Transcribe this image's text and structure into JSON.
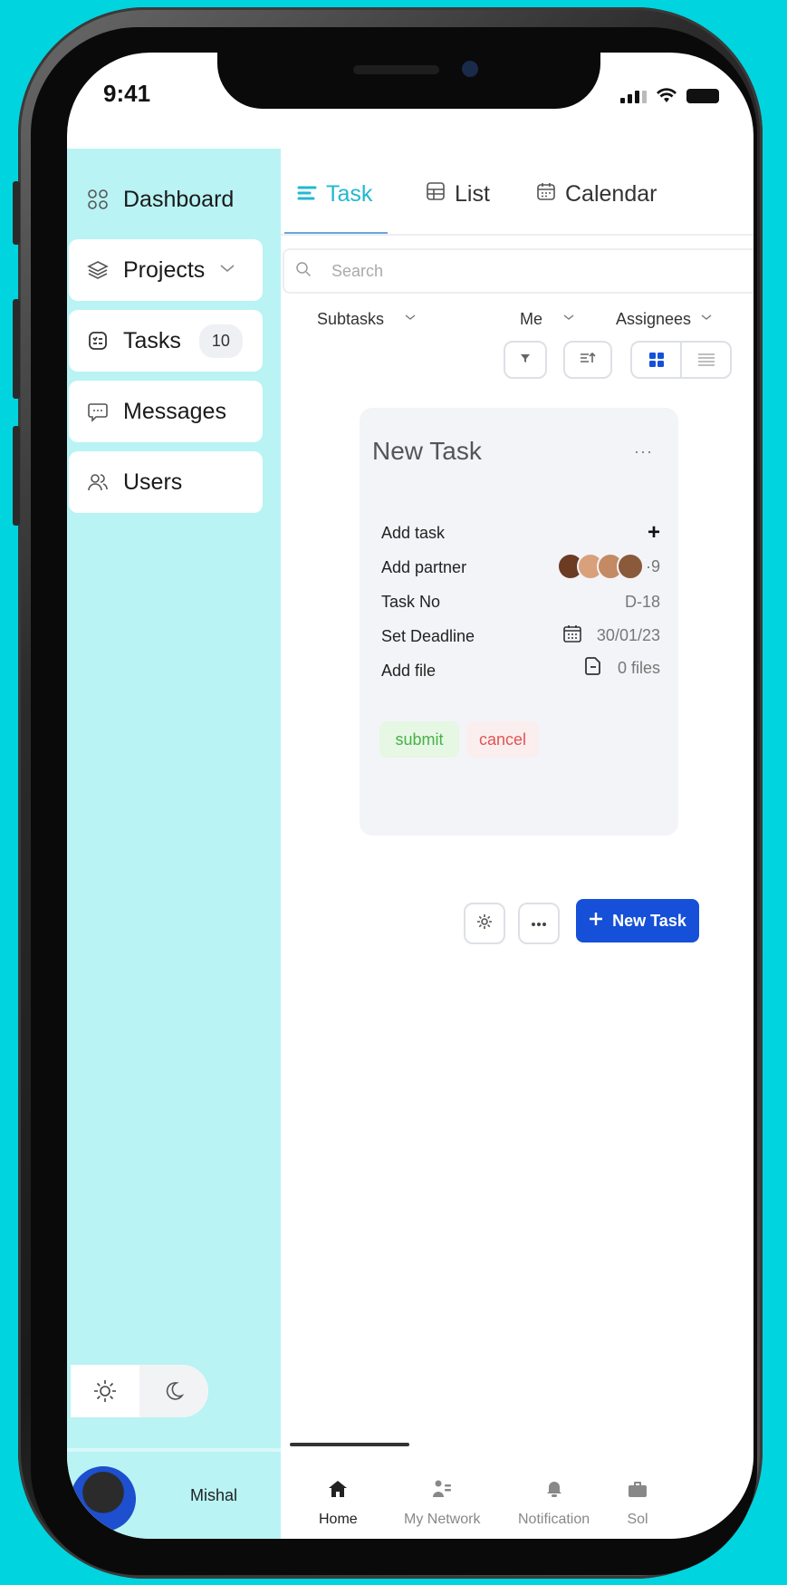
{
  "status_bar": {
    "time": "9:41"
  },
  "sidebar": {
    "items": [
      {
        "label": "Dashboard",
        "icon": "grid-icon"
      },
      {
        "label": "Projects",
        "icon": "layers-icon",
        "has_chevron": true
      },
      {
        "label": "Tasks",
        "icon": "tasklist-icon",
        "badge": "10"
      },
      {
        "label": "Messages",
        "icon": "message-icon"
      },
      {
        "label": "Users",
        "icon": "users-icon"
      }
    ],
    "user_name": "Mishal"
  },
  "tabs": [
    {
      "label": "Task",
      "icon": "lines-icon",
      "active": true
    },
    {
      "label": "List",
      "icon": "table-icon"
    },
    {
      "label": "Calendar",
      "icon": "calendar-icon"
    }
  ],
  "search": {
    "placeholder": "Search"
  },
  "filters": {
    "subtasks": "Subtasks",
    "me": "Me",
    "assignees": "Assignees"
  },
  "new_task_card": {
    "title": "New Task",
    "more": "···",
    "fields": {
      "add_task": "Add task",
      "add_partner": "Add partner",
      "partner_extra": "·9",
      "task_no_label": "Task No",
      "task_no": "D-18",
      "deadline_label": "Set Deadline",
      "deadline": "30/01/23",
      "file_label": "Add file",
      "files": "0 files"
    },
    "submit": "submit",
    "cancel": "cancel"
  },
  "actions": {
    "new_task": "New Task"
  },
  "bottom_nav": [
    {
      "label": "Home",
      "icon": "home-icon",
      "active": true
    },
    {
      "label": "My Network",
      "icon": "network-icon"
    },
    {
      "label": "Notification",
      "icon": "bell-icon"
    },
    {
      "label": "Sol",
      "icon": "briefcase-icon"
    }
  ],
  "colors": {
    "accent": "#22b8d1",
    "primary": "#1650d8",
    "sidebar_bg": "#b9f3f4",
    "page_bg": "#00d4df"
  }
}
